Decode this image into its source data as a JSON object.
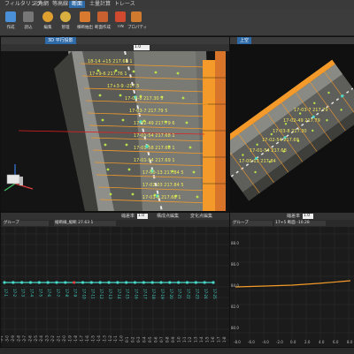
{
  "menu": {
    "tabs": [
      {
        "label": "フィルタリング",
        "active": false
      },
      {
        "label": "三角網",
        "active": false
      },
      {
        "label": "等高線",
        "active": false
      },
      {
        "label": "断面",
        "active": true
      },
      {
        "label": "土量計算",
        "active": false
      },
      {
        "label": "トレース",
        "active": false
      }
    ]
  },
  "ribbon": {
    "buttons": [
      {
        "label": "作成",
        "icon": "create-icon",
        "color": "#4a90d9"
      },
      {
        "label": "読込",
        "icon": "import-icon",
        "color": "#777777"
      },
      {
        "label": "編集",
        "icon": "edit-icon",
        "color": "#e0a030"
      },
      {
        "label": "管理",
        "icon": "manage-icon",
        "color": "#d9b040"
      },
      {
        "label": "横断抽出",
        "icon": "cross-section-icon",
        "color": "#d97a30"
      },
      {
        "label": "断面作成",
        "icon": "section-create-icon",
        "color": "#c86030"
      },
      {
        "label": "TIN",
        "icon": "tin-icon",
        "color": "#d04a30"
      },
      {
        "label": "プロパティ",
        "icon": "property-icon",
        "color": "#d07a30"
      }
    ]
  },
  "view3d": {
    "tab": "3D 平行投影",
    "zoom_label": "1.0",
    "section_labels": [
      "18-14 +15 217.68 1",
      "17+9-6 217.76 1",
      "17+3-9 -217.5",
      "17-03-8 217.30 5",
      "17-03-7 217.79 5",
      "17-02-49 217.79 6",
      "17-01-54 217.68 1",
      "17-01-58 217.68 1",
      "17-01-54 217.69 1",
      "17-00-13 217.84 5",
      "17-02-03 217.84 5",
      "17-03-8 217.68 1"
    ]
  },
  "viewtop": {
    "tab": "上空",
    "section_labels": [
      "17-03-8 217.30",
      "17-02-54 217.69",
      "17-01-54 217.68",
      "17-00-13 217.84",
      "17-02-49 217.79",
      "17-03-7 217.79"
    ]
  },
  "profile": {
    "zoom_label": "縮差率",
    "zoom_value": "1.0",
    "edit_button": "構成点編集",
    "change_button": "変化点編集",
    "group_label": "グループ",
    "line_label": "縦断線_縦断 27.63 1",
    "x_labels": [
      "-3-1",
      "-3-0",
      "-2-9",
      "-2-8",
      "-2-7",
      "-2-6",
      "-2-5",
      "-2-4",
      "-2-3",
      "-2-2",
      "-2-1",
      "-2-0",
      "-1-9",
      "-1-8",
      "-1-7",
      "-1-6",
      "-1-5",
      "-1-4",
      "-1-3",
      "-1-2",
      "-1-1",
      "-1-0",
      "0-1",
      "0-2",
      "0-3",
      "0-4",
      "0-5",
      "0-6",
      "0-7",
      "0-8",
      "0-9",
      "1-0",
      "1-1",
      "1-2",
      "1-3",
      "1-4",
      "1-5",
      "1-6",
      "1-7",
      "1-8"
    ],
    "point_labels": [
      "17-1",
      "17-2",
      "17-3",
      "17-4",
      "17-5",
      "17-6",
      "17-7",
      "17-8",
      "17-9",
      "17-10",
      "17-11",
      "17-12",
      "17-13",
      "17-14",
      "17-15",
      "17-16",
      "17-17",
      "17-18",
      "17-19",
      "17-20",
      "17-21",
      "17-22",
      "17-23",
      "17-24",
      "17-25"
    ]
  },
  "cross": {
    "zoom_label": "縮差率",
    "zoom_value": "1.0",
    "group_label": "グループ",
    "line_label": "17+5 断面 -10.28",
    "y_labels": [
      "88.0",
      "86.0",
      "84.0",
      "82.0",
      "80.0"
    ],
    "x_labels": [
      "-8.0",
      "-6.0",
      "-4.0",
      "-2.0",
      "0.0",
      "2.0",
      "4.0",
      "6.0",
      "8.0"
    ]
  },
  "colors": {
    "accent": "#2f6aa8",
    "point_green": "#b9e34a",
    "label_yellow": "#f2ea5a",
    "line_orange": "#f39a2a",
    "profile_cyan": "#46d9c9"
  }
}
